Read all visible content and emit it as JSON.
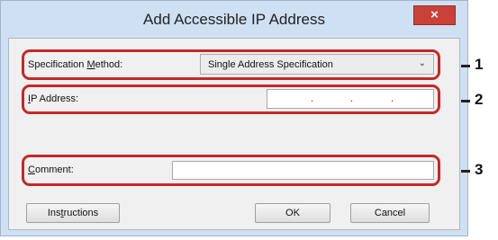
{
  "window": {
    "title": "Add Accessible IP Address",
    "close_glyph": "×"
  },
  "spec_method": {
    "label_before": "Specification ",
    "label_mnemonic": "M",
    "label_after": "ethod:",
    "selected": "Single Address Specification",
    "arrow": "⌄"
  },
  "ip_address": {
    "label_mnemonic": "I",
    "label_after": "P Address:",
    "dots": [
      ".",
      ".",
      "."
    ]
  },
  "comment": {
    "label_mnemonic": "C",
    "label_after": "omment:",
    "value": ""
  },
  "buttons": {
    "instructions_before": "Ins",
    "instructions_mnemonic": "t",
    "instructions_after": "ructions",
    "ok": "OK",
    "cancel": "Cancel"
  },
  "annotations": [
    "1",
    "2",
    "3"
  ],
  "colors": {
    "callout": "#c62828",
    "close_button": "#c8423a",
    "frame": "#cfe0f3"
  }
}
